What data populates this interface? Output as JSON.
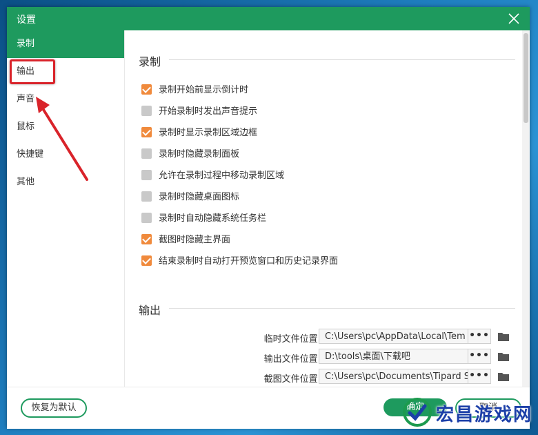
{
  "window": {
    "title": "设置"
  },
  "sidebar": {
    "items": [
      {
        "label": "录制"
      },
      {
        "label": "输出"
      },
      {
        "label": "声音"
      },
      {
        "label": "鼠标"
      },
      {
        "label": "快捷键"
      },
      {
        "label": "其他"
      }
    ],
    "active_index": 0,
    "highlighted_index": 1
  },
  "record": {
    "title": "录制",
    "options": [
      {
        "label": "录制开始前显示倒计时",
        "checked": true
      },
      {
        "label": "开始录制时发出声音提示",
        "checked": false
      },
      {
        "label": "录制时显示录制区域边框",
        "checked": true
      },
      {
        "label": "录制时隐藏录制面板",
        "checked": false
      },
      {
        "label": "允许在录制过程中移动录制区域",
        "checked": false
      },
      {
        "label": "录制时隐藏桌面图标",
        "checked": false
      },
      {
        "label": "录制时自动隐藏系统任务栏",
        "checked": false
      },
      {
        "label": "截图时隐藏主界面",
        "checked": true
      },
      {
        "label": "结束录制时自动打开预览窗口和历史记录界面",
        "checked": true
      }
    ]
  },
  "output": {
    "title": "输出",
    "rows": [
      {
        "label": "临时文件位置:",
        "value": "C:\\Users\\pc\\AppData\\Local\\Tem"
      },
      {
        "label": "输出文件位置:",
        "value": "D:\\tools\\桌面\\下载吧"
      },
      {
        "label": "截图文件位置:",
        "value": "C:\\Users\\pc\\Documents\\Tipard S"
      }
    ],
    "dots_label": "•••"
  },
  "footer": {
    "reset_label": "恢复为默认",
    "ok_label": "确定",
    "cancel_label": "取消"
  },
  "watermark": {
    "text": "宏昌游戏网"
  },
  "colors": {
    "accent": "#1e9a5e",
    "checkbox_on": "#f08a3c",
    "checkbox_off": "#c9c9c9",
    "annotation": "#d9232a"
  }
}
